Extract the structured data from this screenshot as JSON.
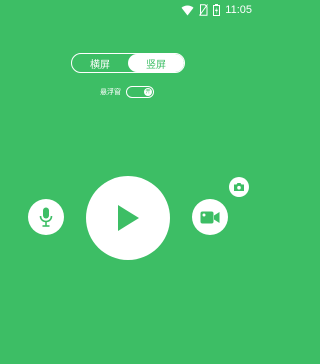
{
  "status_bar": {
    "time": "11:05",
    "icons": [
      "wifi-icon",
      "no-sim-icon",
      "battery-icon"
    ]
  },
  "orientation_toggle": {
    "options": [
      {
        "label": "横屏",
        "selected": false
      },
      {
        "label": "竖屏",
        "selected": true
      }
    ]
  },
  "floating_window": {
    "label": "悬浮窗",
    "switch_text": "开",
    "enabled": true
  },
  "controls": {
    "left": "microphone-icon",
    "center": "play-icon",
    "right": "video-camera-icon",
    "top_right": "camera-icon"
  },
  "colors": {
    "background": "#3dbe65",
    "foreground": "#ffffff"
  }
}
